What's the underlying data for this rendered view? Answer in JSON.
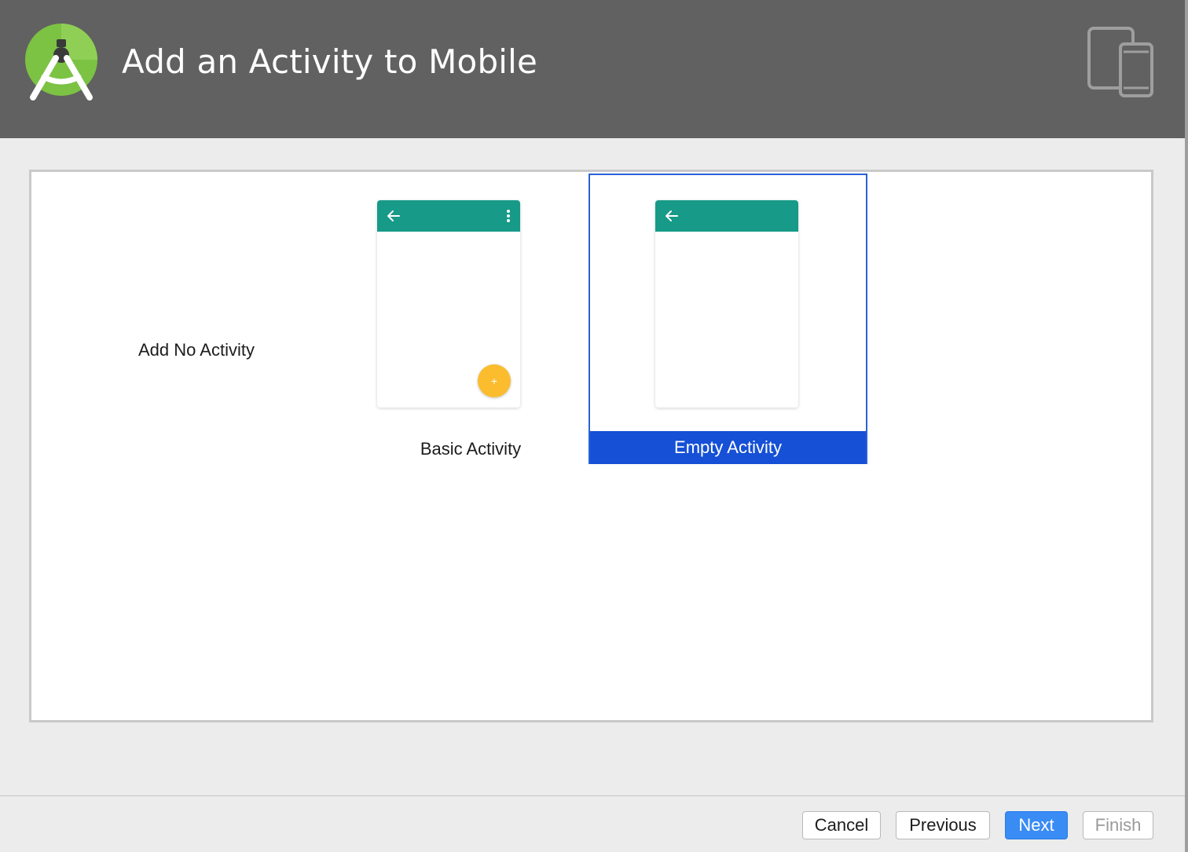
{
  "header": {
    "title": "Add an Activity to Mobile",
    "logo_icon": "android-studio-logo-icon",
    "devices_icon": "tablet-phone-devices-icon"
  },
  "gallery": {
    "items": [
      {
        "label": "Add No Activity",
        "selected": false
      },
      {
        "label": "Basic Activity",
        "selected": false,
        "preview_icons": [
          "back-arrow-icon",
          "overflow-menu-icon",
          "fab-plus-icon"
        ]
      },
      {
        "label": "Empty Activity",
        "selected": true,
        "preview_icons": [
          "back-arrow-icon"
        ]
      }
    ]
  },
  "footer": {
    "cancel_label": "Cancel",
    "previous_label": "Previous",
    "next_label": "Next",
    "finish_label": "Finish"
  },
  "colors": {
    "header_bg": "#616161",
    "toolbar_teal": "#179a88",
    "fab_yellow": "#fbbd2e",
    "selection_blue": "#1550d6",
    "primary_button": "#3a8cf5"
  }
}
